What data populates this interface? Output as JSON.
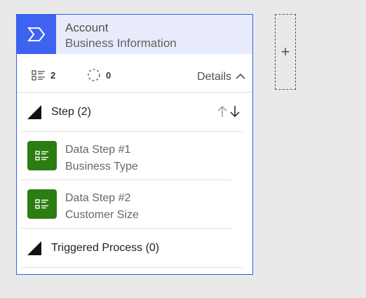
{
  "stage": {
    "title": "Account",
    "subtitle": "Business Information",
    "icon": "chevron-stage-icon",
    "accent": "#3d63f0"
  },
  "stats": {
    "steps_count": "2",
    "steps_icon": "list-icon",
    "conditions_count": "0",
    "conditions_icon": "dashed-circle-icon",
    "details_label": "Details"
  },
  "steps_section": {
    "label": "Step (2)"
  },
  "steps": [
    {
      "title": "Data Step #1",
      "field": "Business Type",
      "icon": "data-step-icon"
    },
    {
      "title": "Data Step #2",
      "field": "Customer Size",
      "icon": "data-step-icon"
    }
  ],
  "triggered_section": {
    "label": "Triggered Process (0)"
  },
  "add_button": {
    "label": "+"
  }
}
